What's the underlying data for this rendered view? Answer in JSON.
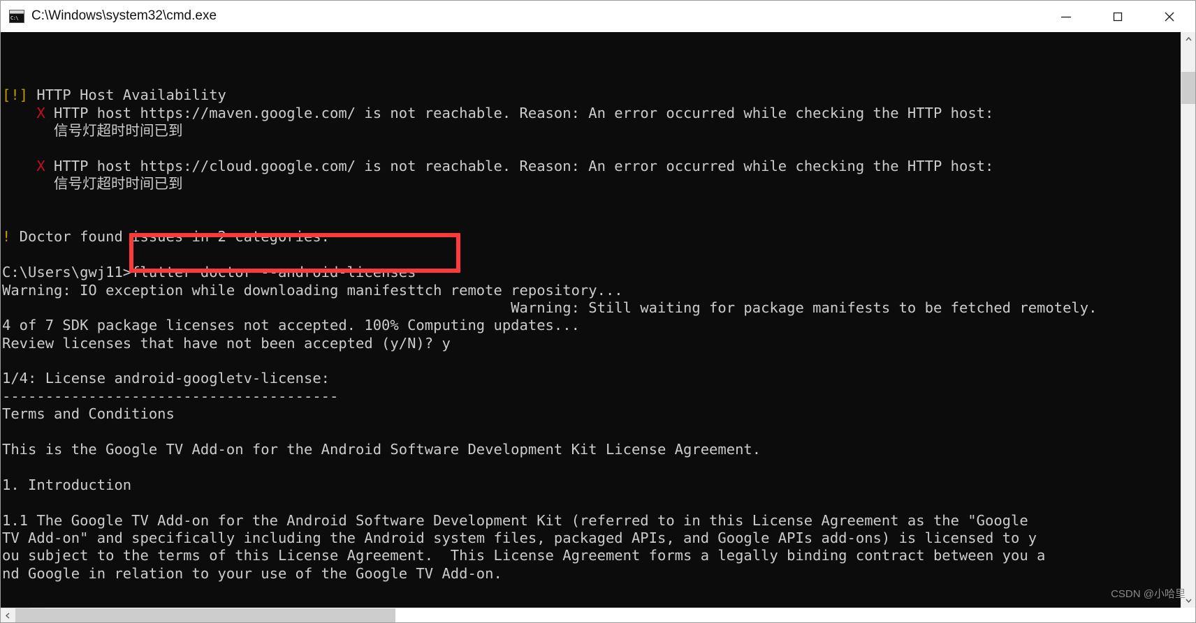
{
  "window": {
    "title": "C:\\Windows\\system32\\cmd.exe",
    "app_icon": "cmd-icon",
    "controls": {
      "minimize": "minimize-icon",
      "maximize": "maximize-icon",
      "close": "close-icon"
    }
  },
  "colors": {
    "console_bg": "#0c0c0c",
    "console_fg": "#cccccc",
    "warning": "#c19c00",
    "error": "#c50f1f",
    "annotation_box": "#fb3b3b",
    "titlebar_bg": "#ffffff",
    "scrollbar_track": "#f0f0f0",
    "scrollbar_thumb": "#cdcdcd"
  },
  "annotation": {
    "type": "red-rectangle-highlight",
    "highlights_text": "flutter doctor --android-licenses"
  },
  "watermark": {
    "text": "CSDN @小哈里"
  },
  "console": {
    "lines": [
      {
        "segments": [
          {
            "text": "[!]",
            "color": "warning"
          },
          {
            "text": " HTTP Host Availability",
            "color": "fg"
          }
        ]
      },
      {
        "segments": [
          {
            "text": "    ",
            "color": "fg"
          },
          {
            "text": "X",
            "color": "error"
          },
          {
            "text": " HTTP host https://maven.google.com/ is not reachable. Reason: An error occurred while checking the HTTP host:",
            "color": "fg"
          }
        ]
      },
      {
        "segments": [
          {
            "text": "      信号灯超时时间已到",
            "color": "fg"
          }
        ]
      },
      {
        "segments": [
          {
            "text": "",
            "color": "fg"
          }
        ]
      },
      {
        "segments": [
          {
            "text": "    ",
            "color": "fg"
          },
          {
            "text": "X",
            "color": "error"
          },
          {
            "text": " HTTP host https://cloud.google.com/ is not reachable. Reason: An error occurred while checking the HTTP host:",
            "color": "fg"
          }
        ]
      },
      {
        "segments": [
          {
            "text": "      信号灯超时时间已到",
            "color": "fg"
          }
        ]
      },
      {
        "segments": [
          {
            "text": "",
            "color": "fg"
          }
        ]
      },
      {
        "segments": [
          {
            "text": "",
            "color": "fg"
          }
        ]
      },
      {
        "segments": [
          {
            "text": "!",
            "color": "warning"
          },
          {
            "text": " Doctor found issues in 2 categories.",
            "color": "fg"
          }
        ]
      },
      {
        "segments": [
          {
            "text": "",
            "color": "fg"
          }
        ]
      },
      {
        "segments": [
          {
            "text": "C:\\Users\\gwj11>flutter doctor --android-licenses",
            "color": "fg"
          }
        ]
      },
      {
        "segments": [
          {
            "text": "Warning: IO exception while downloading manifesttch remote repository...",
            "color": "fg"
          }
        ]
      },
      {
        "segments": [
          {
            "text": "                                                           Warning: Still waiting for package manifests to be fetched remotely.",
            "color": "fg"
          }
        ]
      },
      {
        "segments": [
          {
            "text": "4 of 7 SDK package licenses not accepted. 100% Computing updates...",
            "color": "fg"
          }
        ]
      },
      {
        "segments": [
          {
            "text": "Review licenses that have not been accepted (y/N)? y",
            "color": "fg"
          }
        ]
      },
      {
        "segments": [
          {
            "text": "",
            "color": "fg"
          }
        ]
      },
      {
        "segments": [
          {
            "text": "1/4: License android-googletv-license:",
            "color": "fg"
          }
        ]
      },
      {
        "segments": [
          {
            "text": "---------------------------------------",
            "color": "fg"
          }
        ]
      },
      {
        "segments": [
          {
            "text": "Terms and Conditions",
            "color": "fg"
          }
        ]
      },
      {
        "segments": [
          {
            "text": "",
            "color": "fg"
          }
        ]
      },
      {
        "segments": [
          {
            "text": "This is the Google TV Add-on for the Android Software Development Kit License Agreement.",
            "color": "fg"
          }
        ]
      },
      {
        "segments": [
          {
            "text": "",
            "color": "fg"
          }
        ]
      },
      {
        "segments": [
          {
            "text": "1. Introduction",
            "color": "fg"
          }
        ]
      },
      {
        "segments": [
          {
            "text": "",
            "color": "fg"
          }
        ]
      },
      {
        "segments": [
          {
            "text": "1.1 The Google TV Add-on for the Android Software Development Kit (referred to in this License Agreement as the \"Google",
            "color": "fg"
          }
        ]
      },
      {
        "segments": [
          {
            "text": "TV Add-on\" and specifically including the Android system files, packaged APIs, and Google APIs add-ons) is licensed to y",
            "color": "fg"
          }
        ]
      },
      {
        "segments": [
          {
            "text": "ou subject to the terms of this License Agreement.  This License Agreement forms a legally binding contract between you a",
            "color": "fg"
          }
        ]
      },
      {
        "segments": [
          {
            "text": "nd Google in relation to your use of the Google TV Add-on.",
            "color": "fg"
          }
        ]
      }
    ]
  },
  "scrollbars": {
    "vertical": {
      "up_arrow": "chevron-up-icon",
      "down_arrow": "chevron-down-icon"
    },
    "horizontal": {
      "left_arrow": "chevron-left-icon",
      "right_arrow": "chevron-right-icon"
    }
  }
}
